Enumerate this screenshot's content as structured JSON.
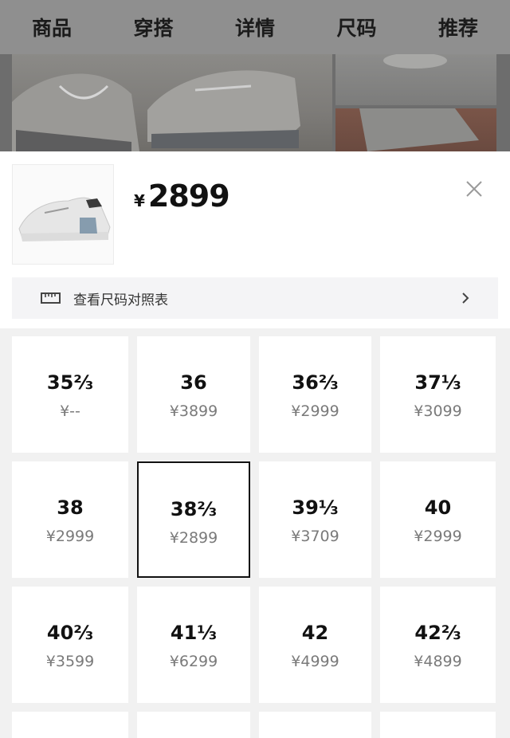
{
  "nav": {
    "tabs": [
      {
        "label": "商品"
      },
      {
        "label": "穿搭"
      },
      {
        "label": "详情"
      },
      {
        "label": "尺码"
      },
      {
        "label": "推荐"
      }
    ],
    "active_index": 1,
    "accent": "#2fb7aa"
  },
  "product": {
    "currency": "¥",
    "price": "2899",
    "close_icon": "close-icon"
  },
  "size_chart": {
    "icon": "ruler-icon",
    "label": "查看尺码对照表"
  },
  "sizes": [
    {
      "size": "35⅔",
      "price": "¥--"
    },
    {
      "size": "36",
      "price": "¥3899"
    },
    {
      "size": "36⅔",
      "price": "¥2999"
    },
    {
      "size": "37⅓",
      "price": "¥3099"
    },
    {
      "size": "38",
      "price": "¥2999"
    },
    {
      "size": "38⅔",
      "price": "¥2899"
    },
    {
      "size": "39⅓",
      "price": "¥3709"
    },
    {
      "size": "40",
      "price": "¥2999"
    },
    {
      "size": "40⅔",
      "price": "¥3599"
    },
    {
      "size": "41⅓",
      "price": "¥6299"
    },
    {
      "size": "42",
      "price": "¥4999"
    },
    {
      "size": "42⅔",
      "price": "¥4899"
    }
  ],
  "selected_size": "38⅔"
}
